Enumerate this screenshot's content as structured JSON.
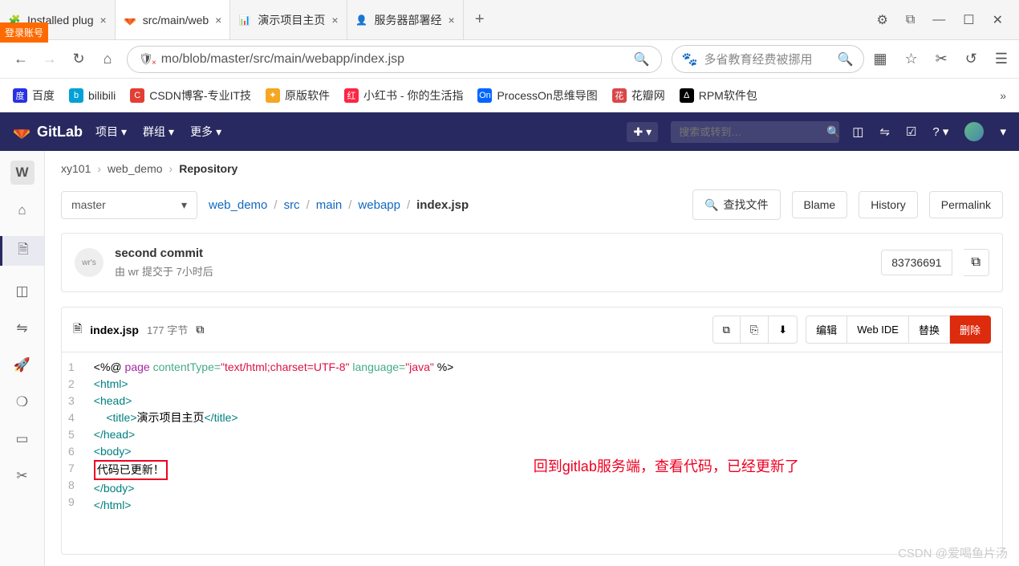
{
  "login_badge": "登录账号",
  "tabs": [
    {
      "title": "Installed plug",
      "active": false
    },
    {
      "title": "src/main/web",
      "active": true
    },
    {
      "title": "演示项目主页",
      "active": false
    },
    {
      "title": "服务器部署经",
      "active": false
    }
  ],
  "window_controls": {
    "settings": "⚙",
    "ext": "⬚",
    "min": "—",
    "max": "☐",
    "close": "✕"
  },
  "addr": {
    "url": "mo/blob/master/src/main/webapp/index.jsp",
    "search_hint": "多省教育经费被挪用"
  },
  "bookmarks": [
    {
      "label": "百度",
      "bg": "#2932e1"
    },
    {
      "label": "bilibili",
      "bg": "#00a1d6"
    },
    {
      "label": "CSDN博客-专业IT技",
      "bg": "#e33e33"
    },
    {
      "label": "原版软件",
      "bg": "#f5a623"
    },
    {
      "label": "小红书 - 你的生活指",
      "bg": "#ff2442"
    },
    {
      "label": "ProcessOn思维导图",
      "bg": "#0066ff",
      "txt": "On"
    },
    {
      "label": "花瓣网",
      "bg": "#d8484a"
    },
    {
      "label": "RPM软件包",
      "bg": "#000",
      "txt": "Δ"
    }
  ],
  "gitlab": {
    "brand": "GitLab",
    "menu": [
      "项目",
      "群组",
      "更多"
    ],
    "search_ph": "搜索或转到…",
    "breadcrumb": {
      "a": "xy101",
      "b": "web_demo",
      "c": "Repository"
    },
    "branch": "master",
    "path": [
      "web_demo",
      "src",
      "main",
      "webapp",
      "index.jsp"
    ],
    "find_btn": "查找文件",
    "blame": "Blame",
    "history": "History",
    "permalink": "Permalink",
    "commit": {
      "title": "second commit",
      "by_prefix": "由 ",
      "author": "wr",
      "mid": " 提交于 ",
      "time": "7小时后",
      "sha": "83736691",
      "avatar_alt": "wr's"
    },
    "file": {
      "name": "index.jsp",
      "size": "177 字节",
      "edit": "编辑",
      "webide": "Web IDE",
      "replace": "替换",
      "delete": "删除"
    },
    "code": {
      "l1a": "<%@ ",
      "l1b": "page",
      "l1c": " contentType=",
      "l1d": "\"text/html;charset=UTF-8\"",
      "l1e": " language=",
      "l1f": "\"java\"",
      "l1g": " %>",
      "l2": "<html>",
      "l3": "<head>",
      "l4a": "    <title>",
      "l4b": "演示项目主页",
      "l4c": "</title>",
      "l5": "</head>",
      "l6": "<body>",
      "l7": "代码已更新！",
      "l8": "</body>",
      "l9": "</html>"
    },
    "annotation": "回到gitlab服务端，查看代码，已经更新了",
    "side_badge": "W"
  },
  "watermark": "CSDN @爱喝鱼片汤"
}
